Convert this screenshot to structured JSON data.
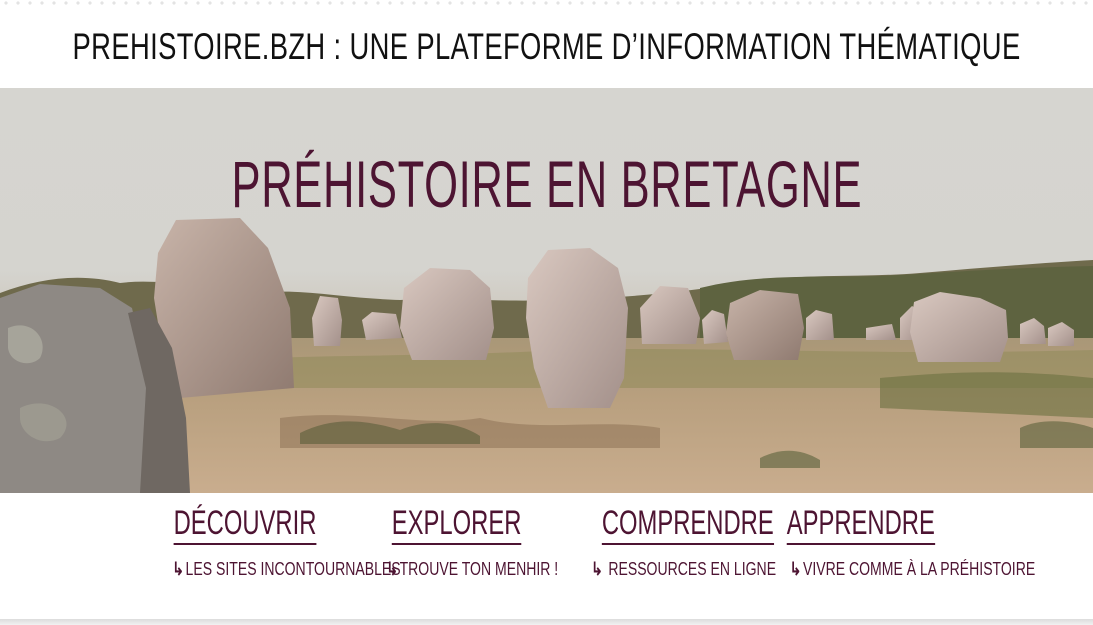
{
  "header": {
    "site_title": "PREHISTOIRE.BZH : UNE PLATEFORME D’INFORMATION THÉMATIQUE"
  },
  "hero": {
    "title": "Préhistoire en bretagne",
    "image_subject": "menhir-alignment-photo"
  },
  "nav": {
    "items": [
      {
        "label": "découvrir",
        "sub_label": "les sites incontournables"
      },
      {
        "label": "explorer",
        "sub_label": "trouve ton menhir !"
      },
      {
        "label": "comprendre",
        "sub_label": " ressources en ligne"
      },
      {
        "label": "apprendre",
        "sub_label": "vivre comme à la préhistoire"
      }
    ],
    "arrow_icon": "↳"
  },
  "colors": {
    "accent": "#4d1432",
    "header_text": "#111111",
    "sky": "#d6d5d0",
    "background": "#ffffff"
  }
}
